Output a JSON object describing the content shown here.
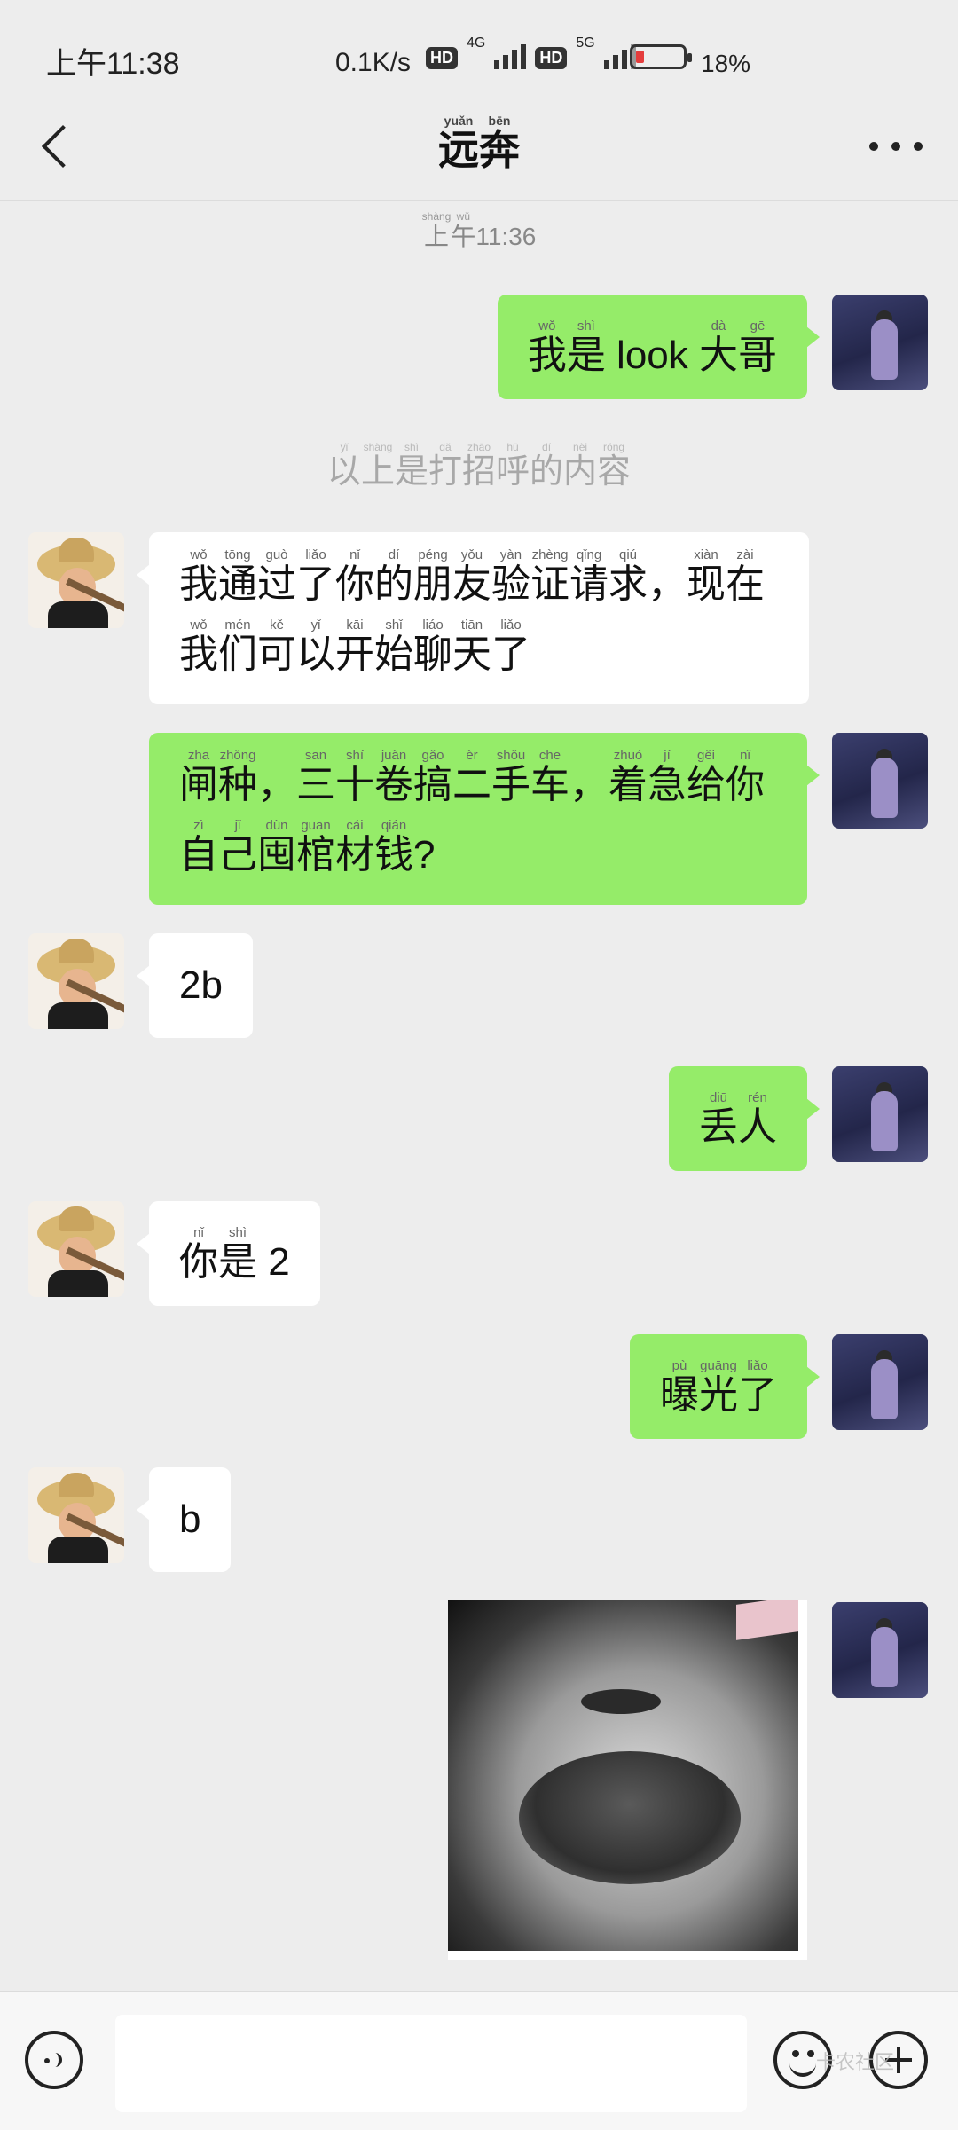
{
  "status_bar": {
    "time": "上午11:38",
    "net_speed": "0.1K/s",
    "hd1": "HD",
    "gen1": "4G",
    "hd2": "HD",
    "gen2": "5G",
    "battery_pct": "18%",
    "battery_level": 0.18,
    "battery_color": "#e43d3d"
  },
  "header": {
    "title_chars": [
      {
        "char": "远",
        "pinyin": "yuǎn"
      },
      {
        "char": "奔",
        "pinyin": "bēn"
      }
    ]
  },
  "chat": {
    "timestamp": [
      {
        "char": "上",
        "pinyin": "shàng"
      },
      {
        "char": "午",
        "pinyin": "wǔ"
      },
      {
        "char": "11:36",
        "pinyin": ""
      }
    ],
    "system_note": [
      {
        "char": "以",
        "pinyin": "yǐ"
      },
      {
        "char": "上",
        "pinyin": "shàng"
      },
      {
        "char": "是",
        "pinyin": "shì"
      },
      {
        "char": "打",
        "pinyin": "dǎ"
      },
      {
        "char": "招",
        "pinyin": "zhāo"
      },
      {
        "char": "呼",
        "pinyin": "hū"
      },
      {
        "char": "的",
        "pinyin": "dí"
      },
      {
        "char": "内",
        "pinyin": "nèi"
      },
      {
        "char": "容",
        "pinyin": "róng"
      }
    ],
    "messages": [
      {
        "side": "me",
        "lines": [
          [
            {
              "char": "我",
              "pinyin": "wǒ"
            },
            {
              "char": "是",
              "pinyin": "shì"
            },
            {
              "char": " look ",
              "pinyin": ""
            },
            {
              "char": "大",
              "pinyin": "dà"
            },
            {
              "char": "哥",
              "pinyin": "gē"
            }
          ]
        ]
      },
      {
        "side": "other",
        "lines": [
          [
            {
              "char": "我",
              "pinyin": "wǒ"
            },
            {
              "char": "通",
              "pinyin": "tōng"
            },
            {
              "char": "过",
              "pinyin": "guò"
            },
            {
              "char": "了",
              "pinyin": "liǎo"
            },
            {
              "char": "你",
              "pinyin": "nǐ"
            },
            {
              "char": "的",
              "pinyin": "dí"
            },
            {
              "char": "朋",
              "pinyin": "péng"
            },
            {
              "char": "友",
              "pinyin": "yǒu"
            },
            {
              "char": "验",
              "pinyin": "yàn"
            },
            {
              "char": "证",
              "pinyin": "zhèng"
            },
            {
              "char": "请",
              "pinyin": "qǐng"
            },
            {
              "char": "求",
              "pinyin": "qiú"
            },
            {
              "char": "，",
              "pinyin": ""
            },
            {
              "char": "现",
              "pinyin": "xiàn"
            },
            {
              "char": "在",
              "pinyin": "zài"
            }
          ],
          [
            {
              "char": "我",
              "pinyin": "wǒ"
            },
            {
              "char": "们",
              "pinyin": "mén"
            },
            {
              "char": "可",
              "pinyin": "kě"
            },
            {
              "char": "以",
              "pinyin": "yǐ"
            },
            {
              "char": "开",
              "pinyin": "kāi"
            },
            {
              "char": "始",
              "pinyin": "shǐ"
            },
            {
              "char": "聊",
              "pinyin": "liáo"
            },
            {
              "char": "天",
              "pinyin": "tiān"
            },
            {
              "char": "了",
              "pinyin": "liǎo"
            }
          ]
        ]
      },
      {
        "side": "me",
        "lines": [
          [
            {
              "char": "闸",
              "pinyin": "zhā"
            },
            {
              "char": "种",
              "pinyin": "zhǒng"
            },
            {
              "char": "，",
              "pinyin": ""
            },
            {
              "char": "三",
              "pinyin": "sān"
            },
            {
              "char": "十",
              "pinyin": "shí"
            },
            {
              "char": "卷",
              "pinyin": "juàn"
            },
            {
              "char": "搞",
              "pinyin": "gǎo"
            },
            {
              "char": "二",
              "pinyin": "èr"
            },
            {
              "char": "手",
              "pinyin": "shǒu"
            },
            {
              "char": "车",
              "pinyin": "chē"
            },
            {
              "char": "，",
              "pinyin": ""
            },
            {
              "char": "着",
              "pinyin": "zhuó"
            },
            {
              "char": "急",
              "pinyin": "jí"
            },
            {
              "char": "给",
              "pinyin": "gěi"
            },
            {
              "char": "你",
              "pinyin": "nǐ"
            }
          ],
          [
            {
              "char": "自",
              "pinyin": "zì"
            },
            {
              "char": "己",
              "pinyin": "jǐ"
            },
            {
              "char": "囤",
              "pinyin": "dùn"
            },
            {
              "char": "棺",
              "pinyin": "guān"
            },
            {
              "char": "材",
              "pinyin": "cái"
            },
            {
              "char": "钱",
              "pinyin": "qián"
            },
            {
              "char": "?",
              "pinyin": ""
            }
          ]
        ]
      },
      {
        "side": "other",
        "lines": [
          [
            {
              "char": "2b",
              "pinyin": ""
            }
          ]
        ]
      },
      {
        "side": "me",
        "lines": [
          [
            {
              "char": "丢",
              "pinyin": "diū"
            },
            {
              "char": "人",
              "pinyin": "rén"
            }
          ]
        ]
      },
      {
        "side": "other",
        "lines": [
          [
            {
              "char": "你",
              "pinyin": "nǐ"
            },
            {
              "char": "是",
              "pinyin": "shì"
            },
            {
              "char": " 2",
              "pinyin": ""
            }
          ]
        ]
      },
      {
        "side": "me",
        "lines": [
          [
            {
              "char": "曝",
              "pinyin": "pù"
            },
            {
              "char": "光",
              "pinyin": "guāng"
            },
            {
              "char": "了",
              "pinyin": "liǎo"
            }
          ]
        ]
      },
      {
        "side": "other",
        "lines": [
          [
            {
              "char": "b",
              "pinyin": ""
            }
          ]
        ]
      }
    ]
  },
  "bottom_bar": {
    "voice_icon": "voice-icon",
    "emoji_icon": "emoji-icon",
    "plus_icon": "plus-icon",
    "watermark": "卡农社区"
  },
  "colors": {
    "my_bubble": "#95ec69",
    "their_bubble": "#ffffff",
    "background": "#ededed"
  }
}
